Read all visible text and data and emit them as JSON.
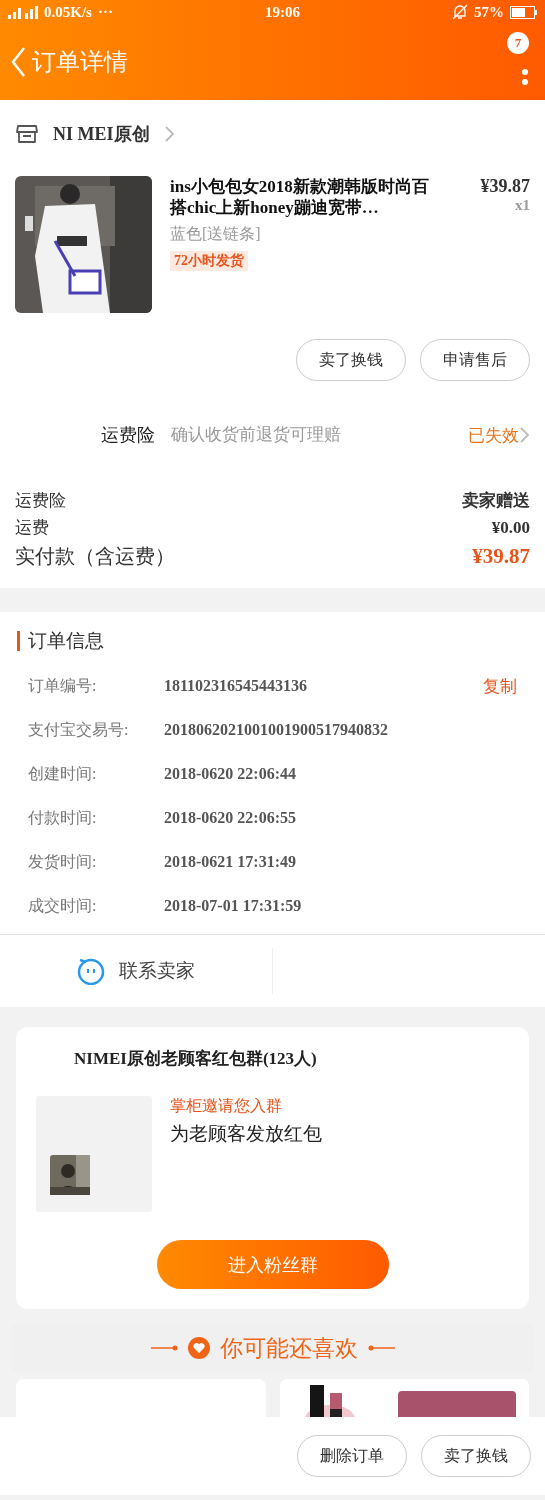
{
  "status_bar": {
    "speed": "0.05K/s",
    "more": "···",
    "time": "19:06",
    "battery": "57%"
  },
  "header": {
    "title": "订单详情",
    "badge": "7"
  },
  "shop": {
    "name": "NI MEI原创"
  },
  "product": {
    "title": "ins小包包女2018新款潮韩版时尚百搭chic上新honey蹦迪宽带…",
    "price": "¥39.87",
    "quantity": "x1",
    "sku": "蓝色[送链条]",
    "tag": "72小时发货"
  },
  "product_actions": [
    "卖了换钱",
    "申请售后"
  ],
  "insurance": {
    "label": "运费险",
    "description": "确认收货前退货可理赔",
    "status": "已失效"
  },
  "summary": [
    {
      "label": "运费险",
      "value": "卖家赠送",
      "kind": "plain"
    },
    {
      "label": "运费",
      "value": "¥0.00",
      "kind": "plain"
    },
    {
      "label": "实付款（含运费）",
      "value": "¥39.87",
      "kind": "total"
    }
  ],
  "order_info": {
    "title": "订单信息",
    "rows": [
      {
        "label": "订单编号:",
        "value": "181102316545443136",
        "action": "复制"
      },
      {
        "label": "支付宝交易号:",
        "value": "2018062021001001900517940832"
      },
      {
        "label": "创建时间:",
        "value": "2018-0620 22:06:44"
      },
      {
        "label": "付款时间:",
        "value": "2018-0620 22:06:55"
      },
      {
        "label": "发货时间:",
        "value": "2018-0621 17:31:49"
      },
      {
        "label": "成交时间:",
        "value": "2018-07-01 17:31:59"
      }
    ]
  },
  "contact": {
    "label": "联系卖家"
  },
  "group": {
    "name": "NIMEI原创老顾客红包群(123人)",
    "invite": "掌柜邀请您入群",
    "message": "为老顾客发放红包",
    "button": "进入粉丝群"
  },
  "recommend": {
    "title": "你可能还喜欢",
    "items": [
      {
        "kind": "blank"
      },
      {
        "kind": "picture"
      }
    ]
  },
  "bottom_actions": [
    "删除订单",
    "卖了换钱"
  ]
}
